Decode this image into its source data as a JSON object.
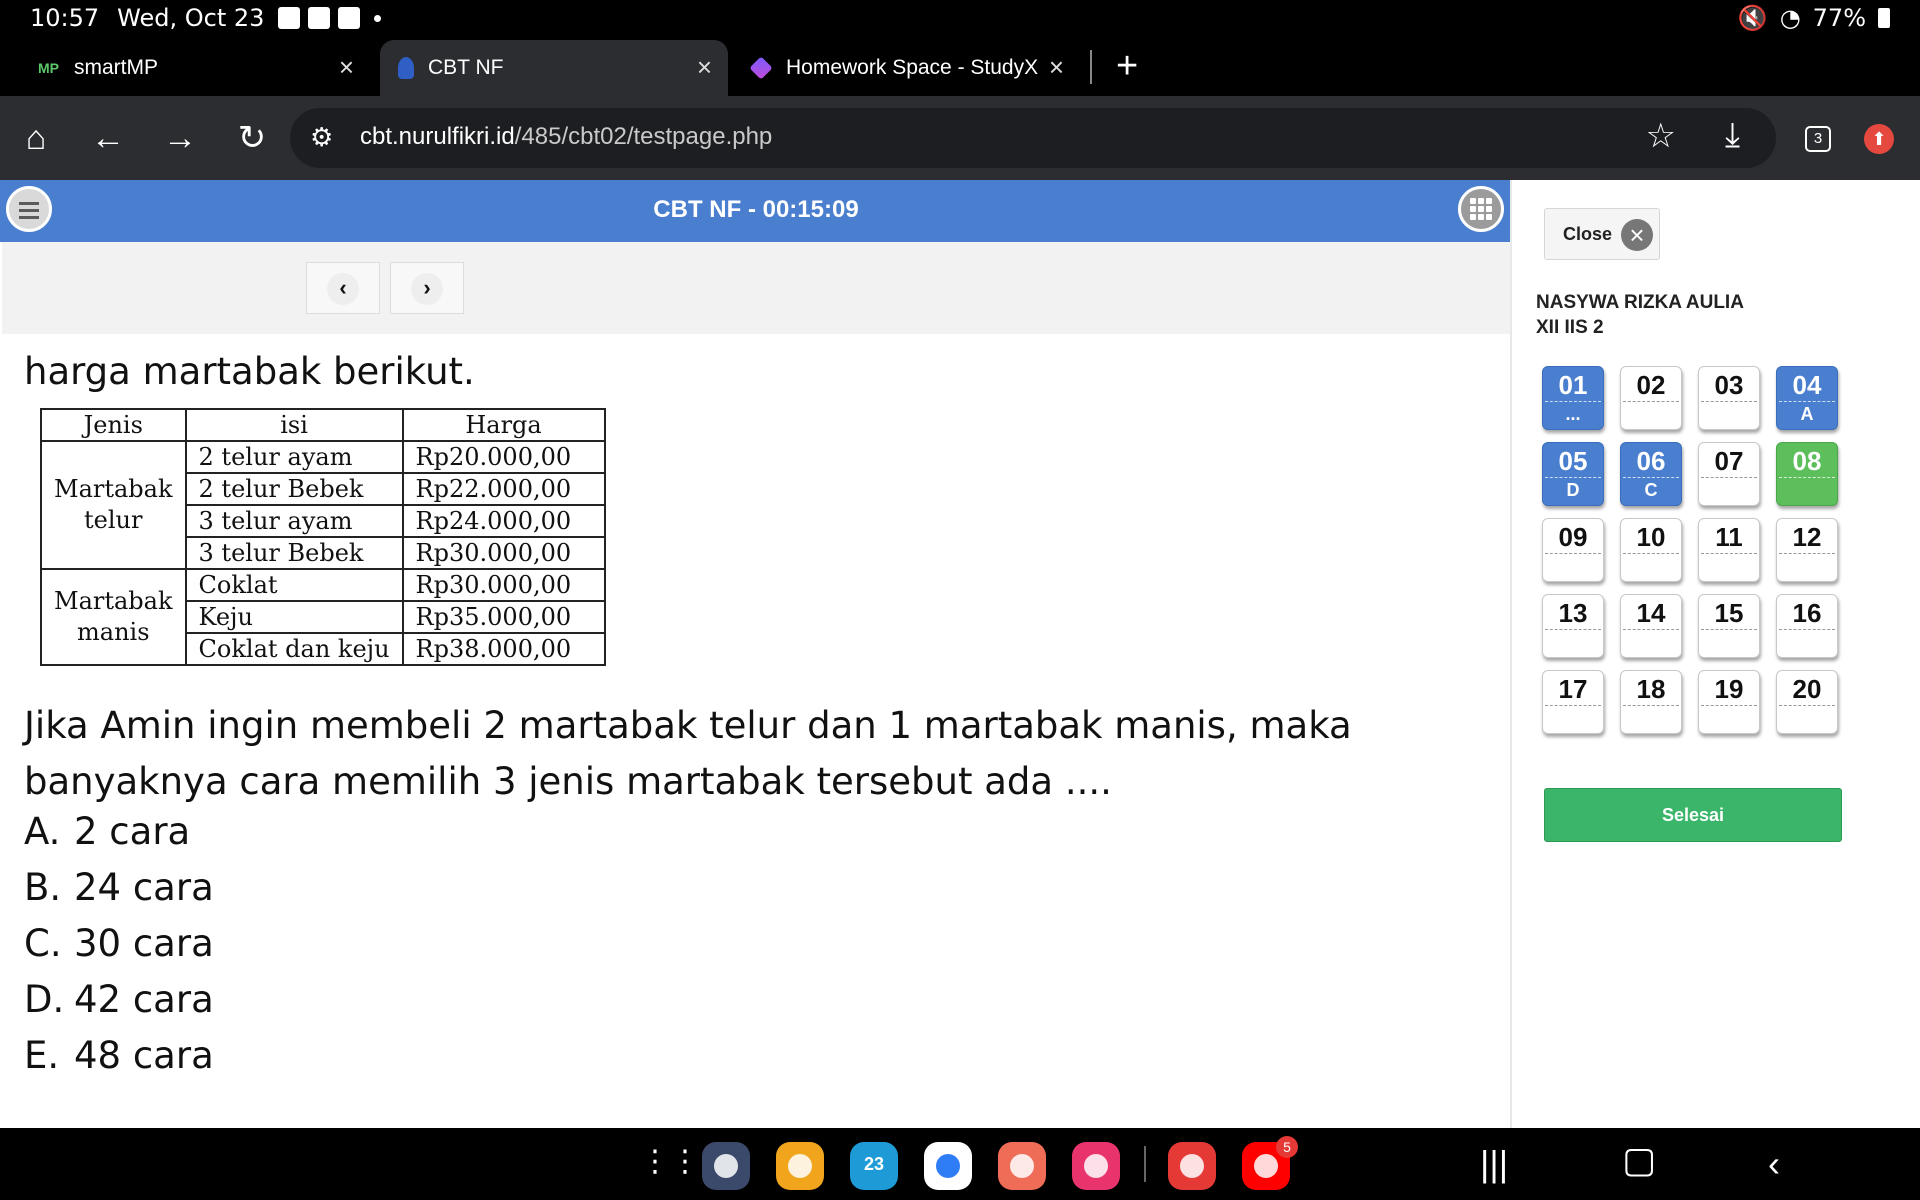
{
  "status": {
    "time": "10:57",
    "date": "Wed, Oct 23",
    "battery": "77%"
  },
  "tabs": [
    {
      "title": "smartMP",
      "favicon_text": "MP"
    },
    {
      "title": "CBT NF"
    },
    {
      "title": "Homework Space - StudyX"
    }
  ],
  "toolbar": {
    "url_host": "cbt.nurulfikri.id",
    "url_path": "/485/cbt02/testpage.php",
    "tab_count": "3"
  },
  "header": {
    "title": "CBT NF - 00:15:09"
  },
  "question": {
    "intro": "harga martabak berikut.",
    "table": {
      "headers": [
        "Jenis",
        "isi",
        "Harga"
      ],
      "groups": [
        {
          "name": "Martabak telur",
          "rows": [
            {
              "isi": "2 telur ayam",
              "harga": "Rp20.000,00"
            },
            {
              "isi": "2 telur Bebek",
              "harga": "Rp22.000,00"
            },
            {
              "isi": "3 telur ayam",
              "harga": "Rp24.000,00"
            },
            {
              "isi": "3 telur Bebek",
              "harga": "Rp30.000,00"
            }
          ]
        },
        {
          "name": "Martabak manis",
          "rows": [
            {
              "isi": "Coklat",
              "harga": "Rp30.000,00"
            },
            {
              "isi": "Keju",
              "harga": "Rp35.000,00"
            },
            {
              "isi": "Coklat dan keju",
              "harga": "Rp38.000,00"
            }
          ]
        }
      ]
    },
    "text": "Jika Amin ingin membeli 2 martabak telur dan 1 martabak manis, maka banyaknya cara memilih 3 jenis martabak tersebut ada ....",
    "options": [
      {
        "letter": "A.",
        "text": "2 cara"
      },
      {
        "letter": "B.",
        "text": "24 cara"
      },
      {
        "letter": "C.",
        "text": "30 cara"
      },
      {
        "letter": "D.",
        "text": "42 cara"
      },
      {
        "letter": "E.",
        "text": "48 cara"
      }
    ]
  },
  "side": {
    "close_label": "Close",
    "student_name": "NASYWA RIZKA AULIA",
    "student_class": "XII IIS 2",
    "finish_label": "Selesai",
    "questions": [
      {
        "num": "01",
        "answer": "...",
        "state": "blue"
      },
      {
        "num": "02",
        "answer": "",
        "state": "empty"
      },
      {
        "num": "03",
        "answer": "",
        "state": "empty"
      },
      {
        "num": "04",
        "answer": "A",
        "state": "blue"
      },
      {
        "num": "05",
        "answer": "D",
        "state": "blue"
      },
      {
        "num": "06",
        "answer": "C",
        "state": "blue"
      },
      {
        "num": "07",
        "answer": "",
        "state": "empty"
      },
      {
        "num": "08",
        "answer": "",
        "state": "green"
      },
      {
        "num": "09",
        "answer": "",
        "state": "empty"
      },
      {
        "num": "10",
        "answer": "",
        "state": "empty"
      },
      {
        "num": "11",
        "answer": "",
        "state": "empty"
      },
      {
        "num": "12",
        "answer": "",
        "state": "empty"
      },
      {
        "num": "13",
        "answer": "",
        "state": "empty"
      },
      {
        "num": "14",
        "answer": "",
        "state": "empty"
      },
      {
        "num": "15",
        "answer": "",
        "state": "empty"
      },
      {
        "num": "16",
        "answer": "",
        "state": "empty"
      },
      {
        "num": "17",
        "answer": "",
        "state": "empty"
      },
      {
        "num": "18",
        "answer": "",
        "state": "empty"
      },
      {
        "num": "19",
        "answer": "",
        "state": "empty"
      },
      {
        "num": "20",
        "answer": "",
        "state": "empty"
      }
    ]
  },
  "taskbar": {
    "youtube_badge": "5",
    "calendar_day": "23",
    "apps": [
      {
        "name": "settings-app-icon",
        "color": "#3b4a6b"
      },
      {
        "name": "files-app-icon",
        "color": "#f0a51c"
      },
      {
        "name": "calendar-app-icon",
        "color": "#1e9bd7"
      },
      {
        "name": "messages-app-icon",
        "color": "#ffffff"
      },
      {
        "name": "contacts-app-icon",
        "color": "#ef6c57"
      },
      {
        "name": "camera-app-icon",
        "color": "#e8336d"
      },
      {
        "name": "notes-app-icon",
        "color": "#e53935"
      },
      {
        "name": "youtube-app-icon",
        "color": "#ff0000"
      }
    ]
  },
  "colors": {
    "header_blue": "#4a7fd0",
    "answered": "#4a7fd0",
    "flagged": "#5cbf5c",
    "finish": "#3ab56a"
  }
}
